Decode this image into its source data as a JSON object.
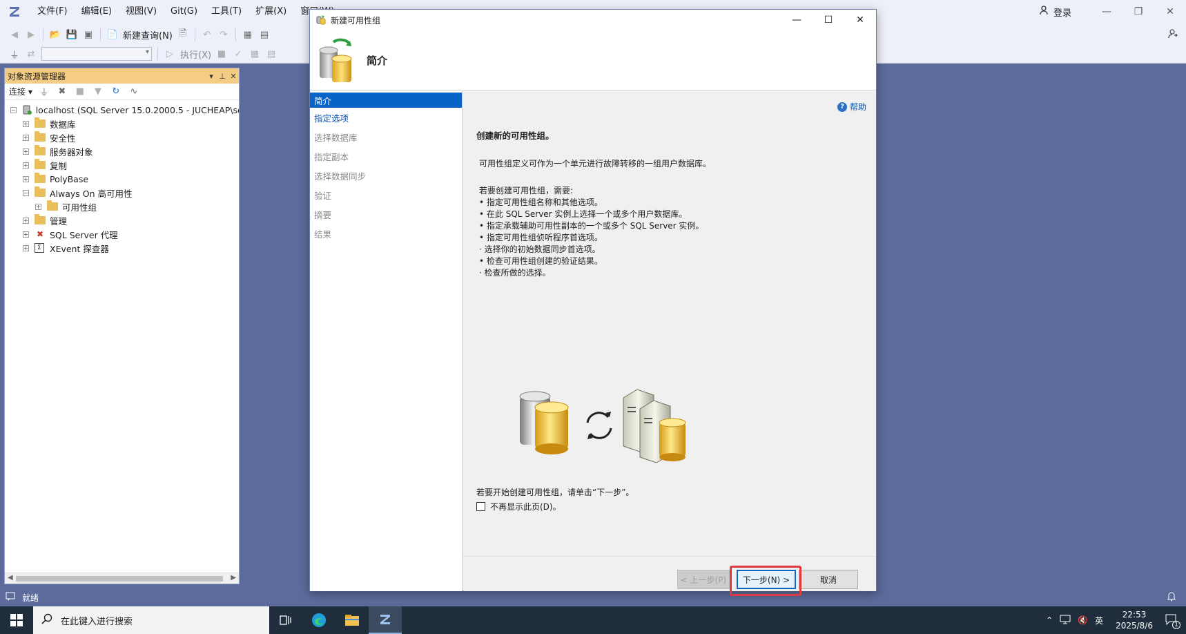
{
  "app": {
    "menu": [
      "文件(F)",
      "编辑(E)",
      "视图(V)",
      "Git(G)",
      "工具(T)",
      "扩展(X)",
      "窗口(W)"
    ],
    "login_label": "登录"
  },
  "toolbar": {
    "new_query_label": "新建查询(N)",
    "execute_label": "执行(X)"
  },
  "object_explorer": {
    "title": "对象资源管理器",
    "connect_label": "连接",
    "root": "localhost (SQL Server 15.0.2000.5 - JUCHEAP\\sqluser)",
    "nodes": [
      {
        "label": "数据库"
      },
      {
        "label": "安全性"
      },
      {
        "label": "服务器对象"
      },
      {
        "label": "复制"
      },
      {
        "label": "PolyBase"
      },
      {
        "label": "Always On 高可用性"
      },
      {
        "label": "可用性组"
      },
      {
        "label": "管理"
      },
      {
        "label": "SQL Server 代理"
      },
      {
        "label": "XEvent 探查器"
      }
    ]
  },
  "status": {
    "text": "就绪"
  },
  "taskbar": {
    "search_placeholder": "在此键入进行搜索",
    "ime": "英",
    "time": "22:53",
    "date": "2025/8/6",
    "notification_count": "1"
  },
  "dialog": {
    "title": "新建可用性组",
    "page_title": "简介",
    "steps": [
      "简介",
      "指定选项",
      "选择数据库",
      "指定副本",
      "选择数据同步",
      "验证",
      "摘要",
      "结果"
    ],
    "help_label": "帮助",
    "heading": "创建新的可用性组。",
    "description": "可用性组定义可作为一个单元进行故障转移的一组用户数据库。",
    "requirements_intro": "若要创建可用性组，需要:",
    "requirements": [
      "• 指定可用性组名称和其他选项。",
      "• 在此 SQL Server 实例上选择一个或多个用户数据库。",
      "• 指定承载辅助可用性副本的一个或多个 SQL Server 实例。",
      "• 指定可用性组侦听程序首选项。",
      "· 选择你的初始数据同步首选项。",
      "• 检查可用性组创建的验证结果。",
      "· 检查所做的选择。"
    ],
    "start_hint": "若要开始创建可用性组，请单击“下一步”。",
    "dont_show_label": "不再显示此页(D)。",
    "dont_show_checked": false,
    "buttons": {
      "back": "< 上一步(P)",
      "next": "下一步(N) >",
      "cancel": "取消"
    }
  },
  "colors": {
    "accent": "#0a64c8",
    "highlight": "#e0393e",
    "panel_header": "#f5cc84",
    "background": "#5c6b9c"
  }
}
